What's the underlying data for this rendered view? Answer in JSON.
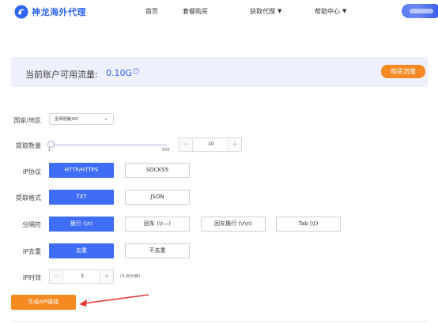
{
  "header": {
    "brand": "神龙海外代理",
    "nav": [
      {
        "label": "首页",
        "dropdown": false
      },
      {
        "label": "套餐购买",
        "dropdown": false
      },
      {
        "label": "获取代理",
        "dropdown": true
      },
      {
        "label": "帮助中心",
        "dropdown": true
      }
    ],
    "brand_color": "#2f66f6"
  },
  "banner": {
    "label": "当前账户可用流量:",
    "value": "0.10G",
    "info_symbol": "?",
    "buy_label": "购买流量"
  },
  "form": {
    "region": {
      "label": "国家/地区",
      "selected": "全球混播(00)"
    },
    "quantity": {
      "label": "提取数量",
      "slider_min": "1",
      "slider_max": "500",
      "value": "10",
      "level": 0.02
    },
    "protocol": {
      "label": "IP协议",
      "options": [
        "HTTP/HTTPS",
        "SOCKS5"
      ],
      "selected": "HTTP/HTTPS"
    },
    "format": {
      "label": "提取格式",
      "options": [
        "TXT",
        "JSON"
      ],
      "selected": "TXT"
    },
    "separator": {
      "label": "分隔符",
      "options": [
        "换行 (\\n)",
        "回车 (\\r—)",
        "回车换行 (\\r\\n)",
        "Tab (\\t)"
      ],
      "selected": "换行 (\\n)"
    },
    "dedupe": {
      "label": "IP去重",
      "options": [
        "去重",
        "不去重"
      ],
      "selected": "去重"
    },
    "validity": {
      "label": "IP时效",
      "value": "3",
      "hint": "(3-30分钟)"
    },
    "generate_label": "生成API链接"
  },
  "colors": {
    "accent": "#3f6df6",
    "orange": "#f58a23",
    "banner_bg": "#eef0fd"
  }
}
